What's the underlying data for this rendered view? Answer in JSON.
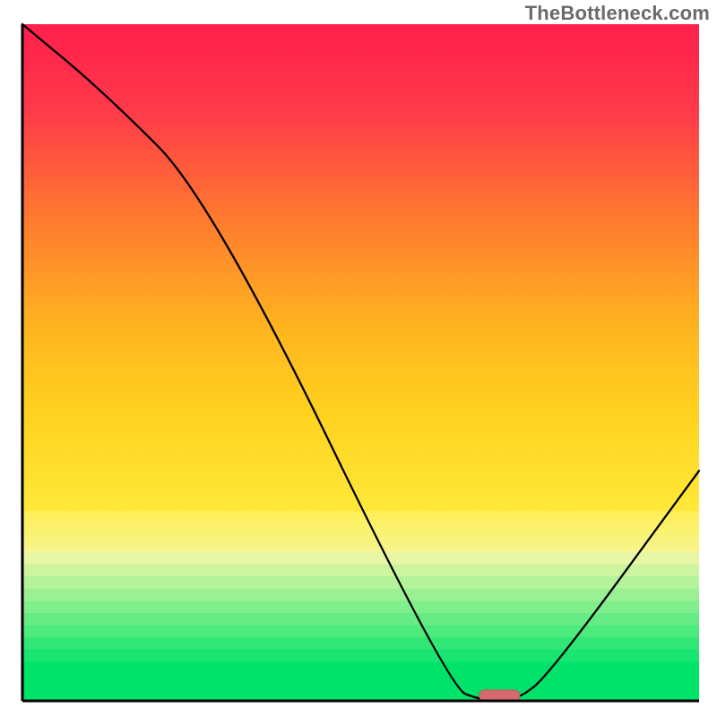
{
  "watermark": {
    "text": "TheBottleneck.com"
  },
  "chart_data": {
    "type": "line",
    "title": "",
    "xlabel": "",
    "ylabel": "",
    "xlim": [
      0,
      100
    ],
    "ylim": [
      0,
      100
    ],
    "grid": false,
    "legend": false,
    "colors": {
      "gradient_top": "#ff1f4b",
      "gradient_mid_upper": "#ff7a2e",
      "gradient_mid": "#ffd21f",
      "gradient_mid_lower": "#f7f58e",
      "gradient_band_pale": "#d9f7b0",
      "gradient_bottom": "#00e36a",
      "axis": "#000000",
      "curve": "#000000",
      "marker_fill": "#d66a6f",
      "marker_stroke": "#c05a60"
    },
    "axes": {
      "x_axis_y": 0,
      "y_axis_x": 0
    },
    "background_bands_y": [
      {
        "from": 100,
        "to": 28,
        "kind": "smooth-gradient"
      },
      {
        "from": 28,
        "to": 22,
        "kind": "pale-yellow"
      },
      {
        "from": 22,
        "to": 4,
        "kind": "banded-green"
      },
      {
        "from": 4,
        "to": 0,
        "kind": "solid-green"
      }
    ],
    "series": [
      {
        "name": "bottleneck-curve",
        "x": [
          0,
          12,
          28,
          63,
          68,
          73,
          78,
          100
        ],
        "y": [
          100,
          90,
          74,
          2,
          0,
          0,
          4,
          34
        ]
      }
    ],
    "optimum_marker": {
      "x_center": 70.5,
      "y_center": 0.8,
      "width": 6,
      "height": 1.6
    }
  }
}
